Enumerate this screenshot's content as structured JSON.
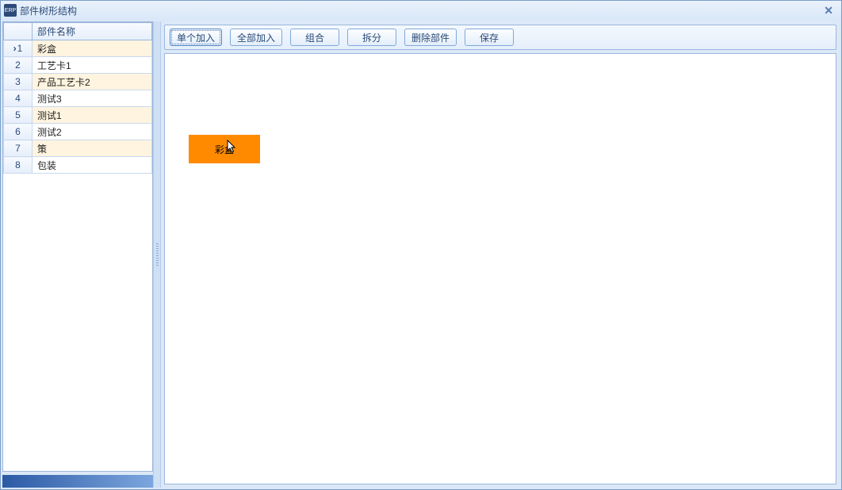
{
  "window": {
    "title": "部件树形结构"
  },
  "sidebar": {
    "col_rownum": "",
    "col_name": "部件名称",
    "rows": [
      {
        "n": "1",
        "name": "彩盒"
      },
      {
        "n": "2",
        "name": "工艺卡1"
      },
      {
        "n": "3",
        "name": "产品工艺卡2"
      },
      {
        "n": "4",
        "name": "测试3"
      },
      {
        "n": "5",
        "name": "测试1"
      },
      {
        "n": "6",
        "name": "测试2"
      },
      {
        "n": "7",
        "name": "策"
      },
      {
        "n": "8",
        "name": "包装"
      }
    ]
  },
  "toolbar": {
    "add_single": "单个加入",
    "add_all": "全部加入",
    "group": "组合",
    "split": "拆分",
    "delete": "删除部件",
    "save": "保存"
  },
  "canvas": {
    "node1_label": "彩盒"
  }
}
